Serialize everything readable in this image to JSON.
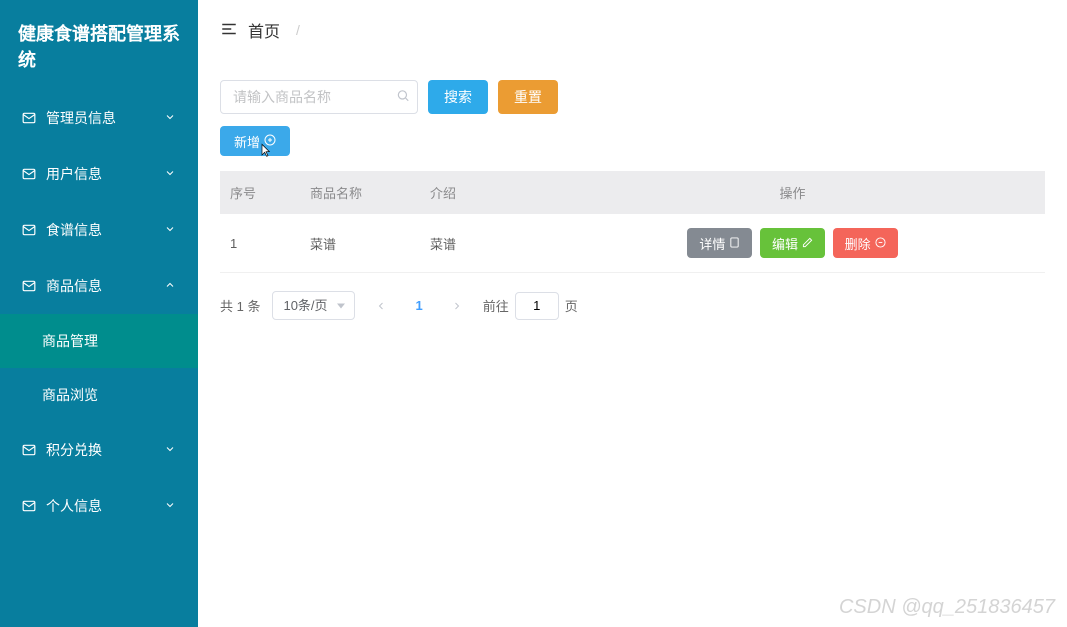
{
  "app_title": "健康食谱搭配管理系统",
  "breadcrumb": {
    "home": "首页",
    "sep": "/"
  },
  "sidebar": {
    "items": [
      {
        "label": "管理员信息"
      },
      {
        "label": "用户信息"
      },
      {
        "label": "食谱信息"
      },
      {
        "label": "商品信息",
        "expanded": true,
        "children": [
          {
            "label": "商品管理",
            "active": true
          },
          {
            "label": "商品浏览"
          }
        ]
      },
      {
        "label": "积分兑换"
      },
      {
        "label": "个人信息"
      }
    ]
  },
  "toolbar": {
    "search_placeholder": "请输入商品名称",
    "search_btn": "搜索",
    "reset_btn": "重置",
    "add_btn": "新增"
  },
  "table": {
    "headers": {
      "index": "序号",
      "name": "商品名称",
      "intro": "介绍",
      "ops": "操作"
    },
    "rows": [
      {
        "index": "1",
        "name": "菜谱",
        "intro": "菜谱"
      }
    ],
    "ops": {
      "detail": "详情",
      "edit": "编辑",
      "delete": "删除"
    }
  },
  "pagination": {
    "total_text": "共 1 条",
    "per_page": "10条/页",
    "current": "1",
    "goto_prefix": "前往",
    "goto_value": "1",
    "goto_suffix": "页"
  },
  "watermark": "CSDN @qq_251836457"
}
